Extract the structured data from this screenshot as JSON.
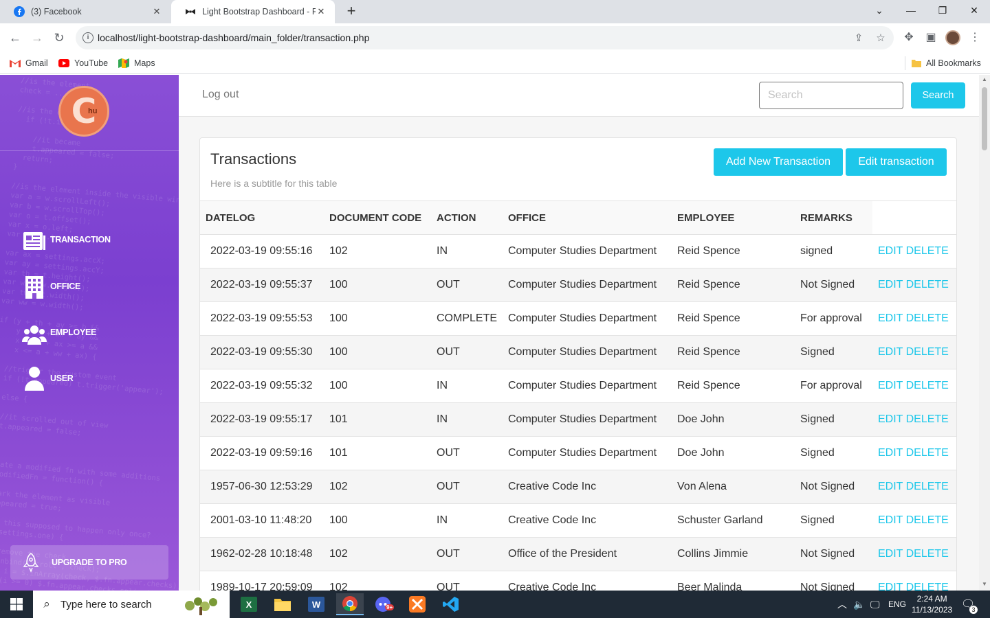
{
  "browser": {
    "tabs": [
      {
        "title": "(3) Facebook",
        "active": false
      },
      {
        "title": "Light Bootstrap Dashboard - Fre",
        "active": true
      }
    ],
    "url": "localhost/light-bootstrap-dashboard/main_folder/transaction.php",
    "bookmarks": [
      {
        "label": "Gmail"
      },
      {
        "label": "YouTube"
      },
      {
        "label": "Maps"
      }
    ],
    "all_bookmarks": "All Bookmarks"
  },
  "sidebar": {
    "logo_text": "C",
    "logo_sub": "hu",
    "items": [
      {
        "label": "TRANSACTION",
        "icon": "newspaper-icon"
      },
      {
        "label": "OFFICE",
        "icon": "building-icon"
      },
      {
        "label": "EMPLOYEE",
        "icon": "users-icon"
      },
      {
        "label": "USER",
        "icon": "user-icon"
      }
    ],
    "upgrade_label": "UPGRADE TO PRO",
    "accent": "#8a4fd6"
  },
  "topnav": {
    "logout": "Log out",
    "search_placeholder": "Search",
    "search_button": "Search"
  },
  "card": {
    "title": "Transactions",
    "subtitle": "Here is a subtitle for this table",
    "add_button": "Add New Transaction",
    "edit_button": "Edit transaction"
  },
  "table": {
    "headers": [
      "DATELOG",
      "DOCUMENT CODE",
      "ACTION",
      "OFFICE",
      "EMPLOYEE",
      "REMARKS"
    ],
    "edit_label": "EDIT",
    "delete_label": "DELETE",
    "rows": [
      {
        "datelog": "2022-03-19 09:55:16",
        "code": "102",
        "action": "IN",
        "office": "Computer Studies Department",
        "employee": "Reid Spence",
        "remarks": "signed"
      },
      {
        "datelog": "2022-03-19 09:55:37",
        "code": "100",
        "action": "OUT",
        "office": "Computer Studies Department",
        "employee": "Reid Spence",
        "remarks": "Not Signed"
      },
      {
        "datelog": "2022-03-19 09:55:53",
        "code": "100",
        "action": "COMPLETE",
        "office": "Computer Studies Department",
        "employee": "Reid Spence",
        "remarks": "For approval"
      },
      {
        "datelog": "2022-03-19 09:55:30",
        "code": "100",
        "action": "OUT",
        "office": "Computer Studies Department",
        "employee": "Reid Spence",
        "remarks": "Signed"
      },
      {
        "datelog": "2022-03-19 09:55:32",
        "code": "100",
        "action": "IN",
        "office": "Computer Studies Department",
        "employee": "Reid Spence",
        "remarks": "For approval"
      },
      {
        "datelog": "2022-03-19 09:55:17",
        "code": "101",
        "action": "IN",
        "office": "Computer Studies Department",
        "employee": "Doe John",
        "remarks": "Signed"
      },
      {
        "datelog": "2022-03-19 09:59:16",
        "code": "101",
        "action": "OUT",
        "office": "Computer Studies Department",
        "employee": "Doe John",
        "remarks": "Signed"
      },
      {
        "datelog": "1957-06-30 12:53:29",
        "code": "102",
        "action": "OUT",
        "office": "Creative Code Inc",
        "employee": "Von Alena",
        "remarks": "Not Signed"
      },
      {
        "datelog": "2001-03-10 11:48:20",
        "code": "100",
        "action": "IN",
        "office": "Creative Code Inc",
        "employee": "Schuster Garland",
        "remarks": "Signed"
      },
      {
        "datelog": "1962-02-28 10:18:48",
        "code": "102",
        "action": "OUT",
        "office": "Office of the President",
        "employee": "Collins Jimmie",
        "remarks": "Not Signed"
      },
      {
        "datelog": "1989-10-17 20:59:09",
        "code": "102",
        "action": "OUT",
        "office": "Creative Code Inc",
        "employee": "Beer Malinda",
        "remarks": "Not Signed"
      }
    ]
  },
  "taskbar": {
    "search_placeholder": "Type here to search",
    "apps": [
      {
        "name": "excel-icon",
        "label": "X"
      },
      {
        "name": "file-explorer-icon",
        "label": ""
      },
      {
        "name": "word-icon",
        "label": "W"
      },
      {
        "name": "chrome-icon",
        "label": ""
      },
      {
        "name": "discord-icon",
        "label": ""
      },
      {
        "name": "xampp-icon",
        "label": ""
      },
      {
        "name": "vscode-icon",
        "label": ""
      }
    ],
    "language": "ENG",
    "time": "2:24 AM",
    "date": "11/13/2023",
    "notification_count": "3",
    "discord_badge": "9+"
  }
}
